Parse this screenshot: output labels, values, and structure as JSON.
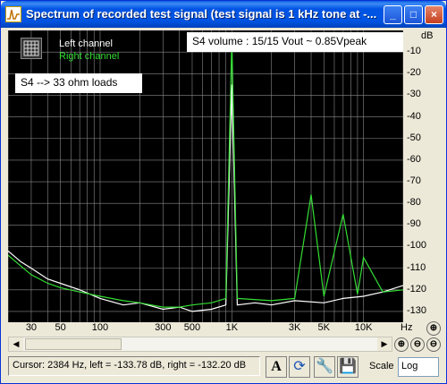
{
  "window": {
    "title": "Spectrum of recorded test signal (test signal is 1 kHz tone at -...",
    "buttons": {
      "minimize": "_",
      "maximize": "□",
      "close": "×"
    }
  },
  "plot": {
    "legend": {
      "left": "Left channel",
      "right": "Right channel"
    },
    "volume_text": "S4 volume :   15/15    Vout ~ 0.85Vpeak",
    "load_text": "S4 -->  33 ohm loads",
    "colors": {
      "background": "#000000",
      "grid": "#8a8a8a",
      "left": "#ffffff",
      "right": "#33dd33"
    }
  },
  "chart_data": {
    "type": "line",
    "xscale": "log",
    "xlim": [
      20,
      20000
    ],
    "ylim": [
      -135,
      0
    ],
    "yunit": "dB",
    "xunit": "Hz",
    "x_ticks": [
      "30",
      "50",
      "100",
      "300",
      "500",
      "1K",
      "3K",
      "5K",
      "10K"
    ],
    "y_ticks": [
      "-10",
      "-20",
      "-30",
      "-40",
      "-50",
      "-60",
      "-70",
      "-80",
      "-90",
      "-100",
      "-110",
      "-120",
      "-130"
    ],
    "series": [
      {
        "name": "Left channel",
        "color": "#ffffff",
        "x": [
          20,
          25,
          30,
          40,
          50,
          70,
          100,
          150,
          200,
          300,
          400,
          500,
          700,
          900,
          1000,
          1100,
          1500,
          2000,
          3000,
          5000,
          7000,
          10000,
          14000,
          20000
        ],
        "y": [
          -102,
          -107,
          -110,
          -115,
          -117,
          -120,
          -124,
          -127,
          -126,
          -129,
          -128,
          -130,
          -129,
          -127,
          -25,
          -127,
          -126,
          -127,
          -125,
          -126,
          -124,
          -123,
          -121,
          -118
        ]
      },
      {
        "name": "Right channel",
        "color": "#33dd33",
        "x": [
          20,
          25,
          30,
          40,
          50,
          70,
          100,
          150,
          200,
          300,
          400,
          500,
          700,
          900,
          1000,
          1100,
          2000,
          3000,
          4000,
          5000,
          7000,
          9000,
          10000,
          14000,
          20000
        ],
        "y": [
          -104,
          -109,
          -113,
          -117,
          -119,
          -121,
          -123,
          -125,
          -126,
          -128,
          -128,
          -127,
          -126,
          -124,
          -4,
          -124,
          -125,
          -124,
          -76,
          -123,
          -85,
          -122,
          -105,
          -121,
          -120
        ]
      }
    ]
  },
  "status": {
    "cursor_text": "Cursor:  2384 Hz,  left = -133.78 dB,  right = -132.20 dB",
    "scale_label": "Scale",
    "scale_value": "Log"
  },
  "toolbar": {
    "font_icon_label": "A",
    "x_label": "Hz"
  }
}
